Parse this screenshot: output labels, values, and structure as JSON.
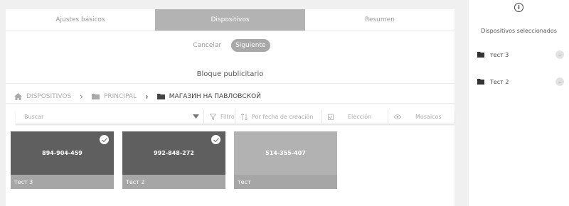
{
  "tabs": [
    {
      "label": "Ajustes básicos"
    },
    {
      "label": "Dispositivos"
    },
    {
      "label": "Resumen"
    }
  ],
  "actions": {
    "cancel": "Cancelar",
    "next": "Siguiente"
  },
  "block_title": "Bloque publicitario",
  "breadcrumb": [
    {
      "label": "DISPOSITIVOS",
      "icon": "home-icon"
    },
    {
      "label": "PRINCIPAL",
      "icon": "folder-icon"
    },
    {
      "label": "МАГАЗИН НА ПАВЛОВСКОЙ",
      "icon": "folder-icon"
    }
  ],
  "toolbar": {
    "search_placeholder": "Buscar",
    "filter": "Filtro",
    "sort": "Por fecha de creación",
    "selection": "Elección",
    "view": "Mosaicos"
  },
  "cards": [
    {
      "code": "894-904-459",
      "name": "тест 3",
      "selected": true
    },
    {
      "code": "992-848-272",
      "name": "Тест 2",
      "selected": true
    },
    {
      "code": "514-355-407",
      "name": "тест",
      "selected": false
    }
  ],
  "sidebar": {
    "title": "Dispositivos seleccionados",
    "items": [
      {
        "name": "тест 3"
      },
      {
        "name": "Тест 2"
      }
    ]
  },
  "colors": {
    "card_dark": "#5f5f5f",
    "card_light": "#b2b2b2",
    "active_tab": "#b3b3b3"
  }
}
